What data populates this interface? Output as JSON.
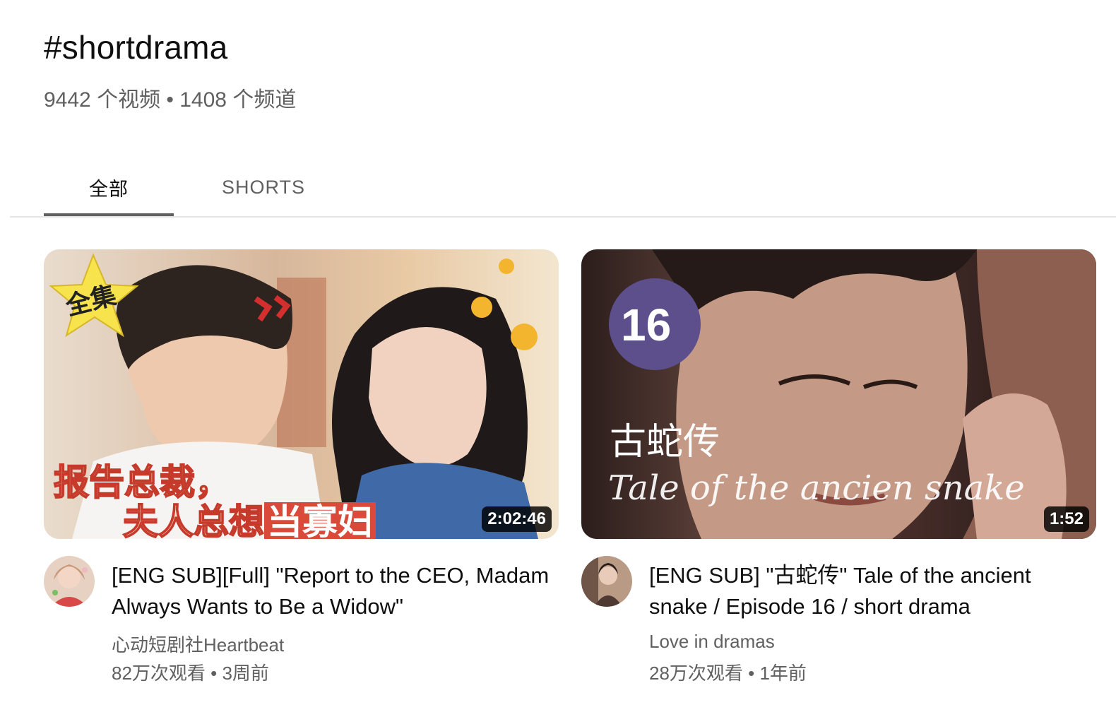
{
  "header": {
    "title": "#shortdrama",
    "meta": "9442 个视频 • 1408 个频道"
  },
  "tabs": [
    {
      "label": "全部",
      "selected": true
    },
    {
      "label": "SHORTS",
      "selected": false
    }
  ],
  "videos": [
    {
      "title": "[ENG SUB][Full] \"Report to the CEO, Madam Always Wants to Be a Widow\"",
      "channel": "心动短剧社Heartbeat",
      "stats": "82万次观看 • 3周前",
      "duration": "2:02:46",
      "thumbnail_text": {
        "badge": "全集",
        "line1": "报告总裁，",
        "line2": "夫人总想",
        "line2_highlight": "当寡妇"
      }
    },
    {
      "title": "[ENG SUB] \"古蛇传\" Tale of the ancient snake / Episode 16 / short drama",
      "channel": "Love in dramas",
      "stats": "28万次观看 • 1年前",
      "duration": "1:52",
      "thumbnail_text": {
        "episode": "16",
        "chinese_title": "古蛇传",
        "english_title": "Tale of the ancien snake"
      }
    }
  ]
}
